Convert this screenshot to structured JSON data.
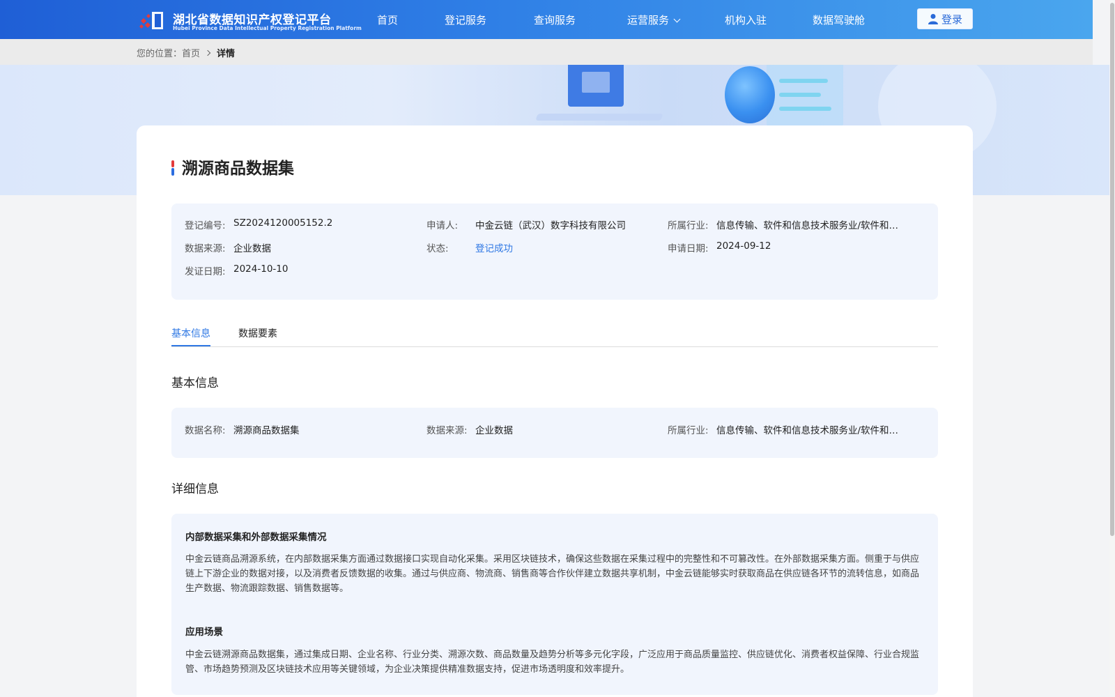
{
  "header": {
    "logo_cn": "湖北省数据知识产权登记平台",
    "logo_en": "Hubei Province Data Intellectual Property Registration Platform",
    "nav": [
      "首页",
      "登记服务",
      "查询服务",
      "运营服务",
      "机构入驻",
      "数据驾驶舱"
    ],
    "login_label": "登录"
  },
  "breadcrumb": {
    "prefix": "您的位置：",
    "home": "首页",
    "current": "详情"
  },
  "page": {
    "title": "溯源商品数据集",
    "summary": [
      {
        "label": "登记编号:",
        "value": "SZ2024120005152.2"
      },
      {
        "label": "申请人:",
        "value": "中金云链（武汉）数字科技有限公司"
      },
      {
        "label": "所属行业:",
        "value": "信息传输、软件和信息技术服务业/软件和…"
      },
      {
        "label": "数据来源:",
        "value": "企业数据"
      },
      {
        "label": "状态:",
        "value": "登记成功"
      },
      {
        "label": "申请日期:",
        "value": "2024-09-12"
      },
      {
        "label": "发证日期:",
        "value": "2024-10-10"
      }
    ],
    "tabs": [
      "基本信息",
      "数据要素"
    ],
    "basic_heading": "基本信息",
    "basic": [
      {
        "label": "数据名称:",
        "value": "溯源商品数据集"
      },
      {
        "label": "数据来源:",
        "value": "企业数据"
      },
      {
        "label": "所属行业:",
        "value": "信息传输、软件和信息技术服务业/软件和…"
      }
    ],
    "detail_heading": "详细信息",
    "details": [
      {
        "title": "内部数据采集和外部数据采集情况",
        "text": "中金云链商品溯源系统，在内部数据采集方面通过数据接口实现自动化采集。采用区块链技术，确保这些数据在采集过程中的完整性和不可篡改性。在外部数据采集方面。侧重于与供应链上下游企业的数据对接，以及消费者反馈数据的收集。通过与供应商、物流商、销售商等合作伙伴建立数据共享机制，中金云链能够实时获取商品在供应链各环节的流转信息，如商品生产数据、物流跟踪数据、销售数据等。"
      },
      {
        "title": "应用场景",
        "text": "中金云链溯源商品数据集，通过集成日期、企业名称、行业分类、溯源次数、商品数量及趋势分析等多元化字段，广泛应用于商品质量监控、供应链优化、消费者权益保障、行业合规监管、市场趋势预测及区块链技术应用等关键领域，为企业决策提供精准数据支持，促进市场透明度和效率提升。"
      }
    ]
  },
  "colors": {
    "accent": "#2f78e4",
    "header_start": "#1f5fd6",
    "header_end": "#4aa6ee"
  }
}
